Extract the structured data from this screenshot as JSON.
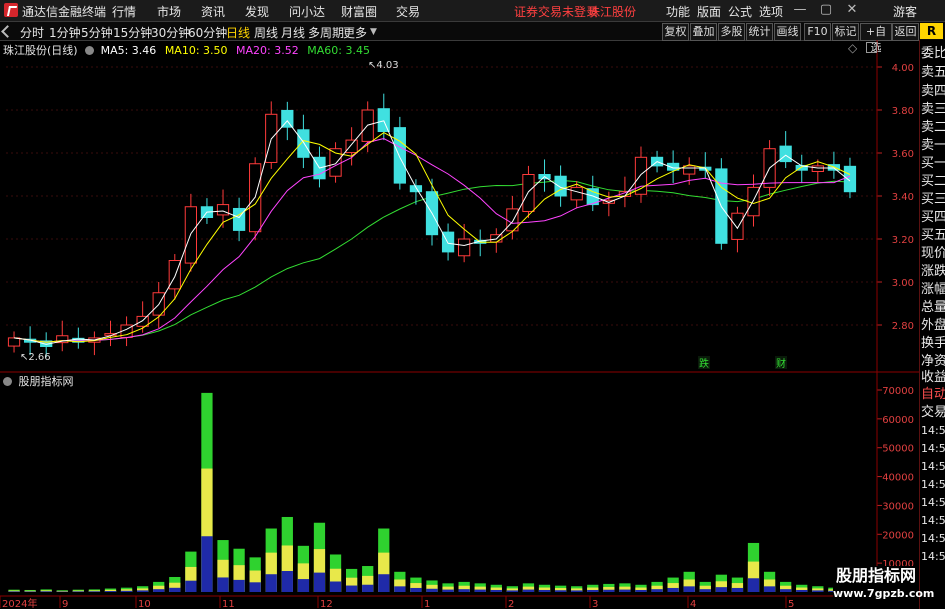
{
  "app": {
    "title": "通达信金融终端",
    "menu": [
      "行情",
      "市场",
      "资讯",
      "发现",
      "问小达",
      "财富圈",
      "交易"
    ],
    "notice": "证券交易未登录",
    "stock_link": "珠江股份",
    "right_menu": [
      "功能",
      "版面",
      "公式",
      "选项"
    ],
    "user": "游客",
    "badge": "R"
  },
  "toolbar": {
    "periods": [
      "分时",
      "1分钟",
      "5分钟",
      "15分钟",
      "30分钟",
      "60分钟",
      "日线",
      "周线",
      "月线",
      "多周期",
      "更多"
    ],
    "active_period": "日线",
    "buttons": [
      "复权",
      "叠加",
      "多股",
      "统计",
      "画线",
      "F10",
      "标记",
      "+自选",
      "返回"
    ]
  },
  "chart_header": {
    "title": "珠江股份(日线)",
    "ma5": "MA5: 3.46",
    "ma10": "MA10: 3.50",
    "ma20": "MA20: 3.52",
    "ma60": "MA60: 3.45",
    "ma5_color": "#ffffff",
    "ma10_color": "#ffff00",
    "ma20_color": "#ff44ff",
    "ma60_color": "#33dd33"
  },
  "volume_panel": {
    "title": "股朋指标网"
  },
  "side_panel": {
    "upper": [
      "委比",
      "卖五",
      "卖四",
      "卖三",
      "卖二",
      "卖一",
      "买一",
      "买二",
      "买三",
      "买四",
      "买五",
      "现价",
      "涨跌",
      "涨幅",
      "总量",
      "外盘",
      "换手",
      "净资",
      "收益"
    ],
    "lower": [
      "自动",
      "交易",
      "14:5",
      "14:5",
      "14:5",
      "14:5",
      "14:5",
      "14:5",
      "14:5",
      "14:5"
    ]
  },
  "watermark": {
    "line1": "股朋指标网",
    "line2": "www.7gpzb.com"
  },
  "chart_data": [
    {
      "type": "candlestick",
      "y_ticks": [
        "4.00",
        "3.80",
        "3.60",
        "3.40",
        "3.20",
        "3.00",
        "2.80"
      ],
      "ylim": [
        2.62,
        4.07
      ],
      "annotations": {
        "high": "4.03",
        "low": "2.66",
        "event1": "跌",
        "event2": "财"
      },
      "x_ticks": [
        "2024年",
        "9",
        "10",
        "11",
        "12",
        "1",
        "2",
        "3",
        "4",
        "5"
      ],
      "close_approx": [
        2.74,
        2.72,
        2.7,
        2.75,
        2.72,
        2.74,
        2.76,
        2.8,
        2.84,
        2.95,
        3.1,
        3.35,
        3.3,
        3.36,
        3.24,
        3.55,
        3.78,
        3.72,
        3.58,
        3.48,
        3.62,
        3.66,
        3.8,
        3.7,
        3.46,
        3.42,
        3.22,
        3.14,
        3.2,
        3.18,
        3.22,
        3.34,
        3.5,
        3.48,
        3.4,
        3.44,
        3.36,
        3.38,
        3.42,
        3.58,
        3.54,
        3.52,
        3.54,
        3.52,
        3.18,
        3.32,
        3.44,
        3.62,
        3.56,
        3.52,
        3.54,
        3.52,
        3.42
      ]
    },
    {
      "type": "bar",
      "name": "volume",
      "y_ticks": [
        "70000",
        "60000",
        "50000",
        "40000",
        "30000",
        "20000",
        "10000"
      ],
      "ylim": [
        0,
        73000
      ],
      "values_approx": [
        800,
        700,
        900,
        600,
        800,
        900,
        1200,
        1500,
        2000,
        3500,
        5200,
        14000,
        69000,
        18000,
        15000,
        12000,
        22000,
        26000,
        16000,
        24000,
        13000,
        8000,
        9000,
        22000,
        7000,
        5000,
        4000,
        3000,
        3500,
        3000,
        2500,
        2000,
        3000,
        2500,
        2200,
        2000,
        2500,
        2800,
        3000,
        2500,
        3500,
        5000,
        7000,
        3500,
        6000,
        5000,
        17000,
        7000,
        3500,
        2500,
        2000,
        1500,
        1200
      ]
    }
  ]
}
